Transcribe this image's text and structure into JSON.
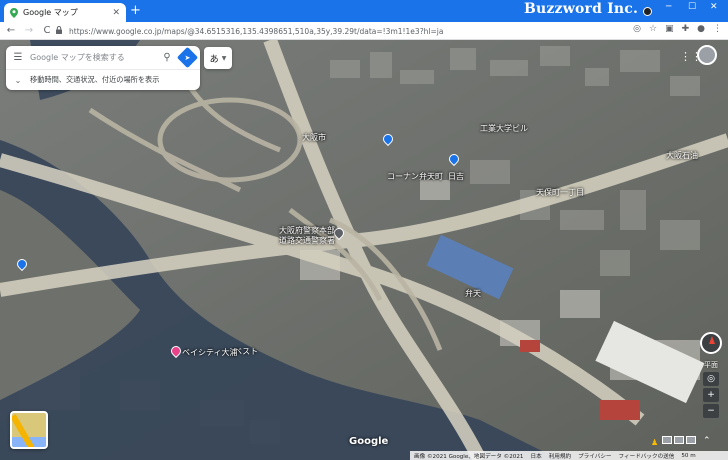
{
  "browser": {
    "tab_title": "Google マップ",
    "tab_close": "✕",
    "new_tab": "+",
    "brand": "Buzzword Inc.",
    "window_controls": [
      "─",
      "☐",
      "✕"
    ],
    "url": "https://www.google.co.jp/maps/@34.6515316,135.4398651,510a,35y,39.29t/data=!3m1!1e3?hl=ja",
    "nav": {
      "back": "←",
      "forward": "→",
      "reload": "C"
    },
    "toolbar_icons": [
      "google-lens-icon",
      "star-icon",
      "cast-icon",
      "extensions-icon",
      "profile-icon",
      "more-icon"
    ]
  },
  "map": {
    "search": {
      "placeholder": "Google マップを検索する",
      "menu_icon": "☰",
      "search_icon": "⚲",
      "directions_icon": "➤"
    },
    "suggestion": {
      "chevron": "⌄",
      "text": "移動時間、交通状況、付近の場所を表示"
    },
    "ime": {
      "char": "あ",
      "arrow": "▼"
    },
    "labels": [
      {
        "text": "工業大学ビル"
      },
      {
        "text": "コーナン弁天町"
      },
      {
        "text": "日吉"
      },
      {
        "text": "大阪石油"
      },
      {
        "text": "天保町一丁目"
      },
      {
        "text": "大阪府警察本部"
      },
      {
        "text": "道路交通警察署"
      },
      {
        "text": "ベスト"
      },
      {
        "text": "ベイシティ大浦"
      },
      {
        "text": "弁天"
      },
      {
        "text": "大阪市"
      }
    ],
    "controls": {
      "tilt_label": "平面",
      "zoom_in": "+",
      "zoom_out": "−",
      "locate": "◎",
      "expand": "⌃"
    },
    "watermark": "Google",
    "status": {
      "imagery": "画像 ©2021 Google、地図データ ©2021",
      "japan": "日本",
      "terms": "利用規約",
      "privacy": "プライバシー",
      "feedback": "フィードバックの送信",
      "scale": "50 m"
    }
  }
}
